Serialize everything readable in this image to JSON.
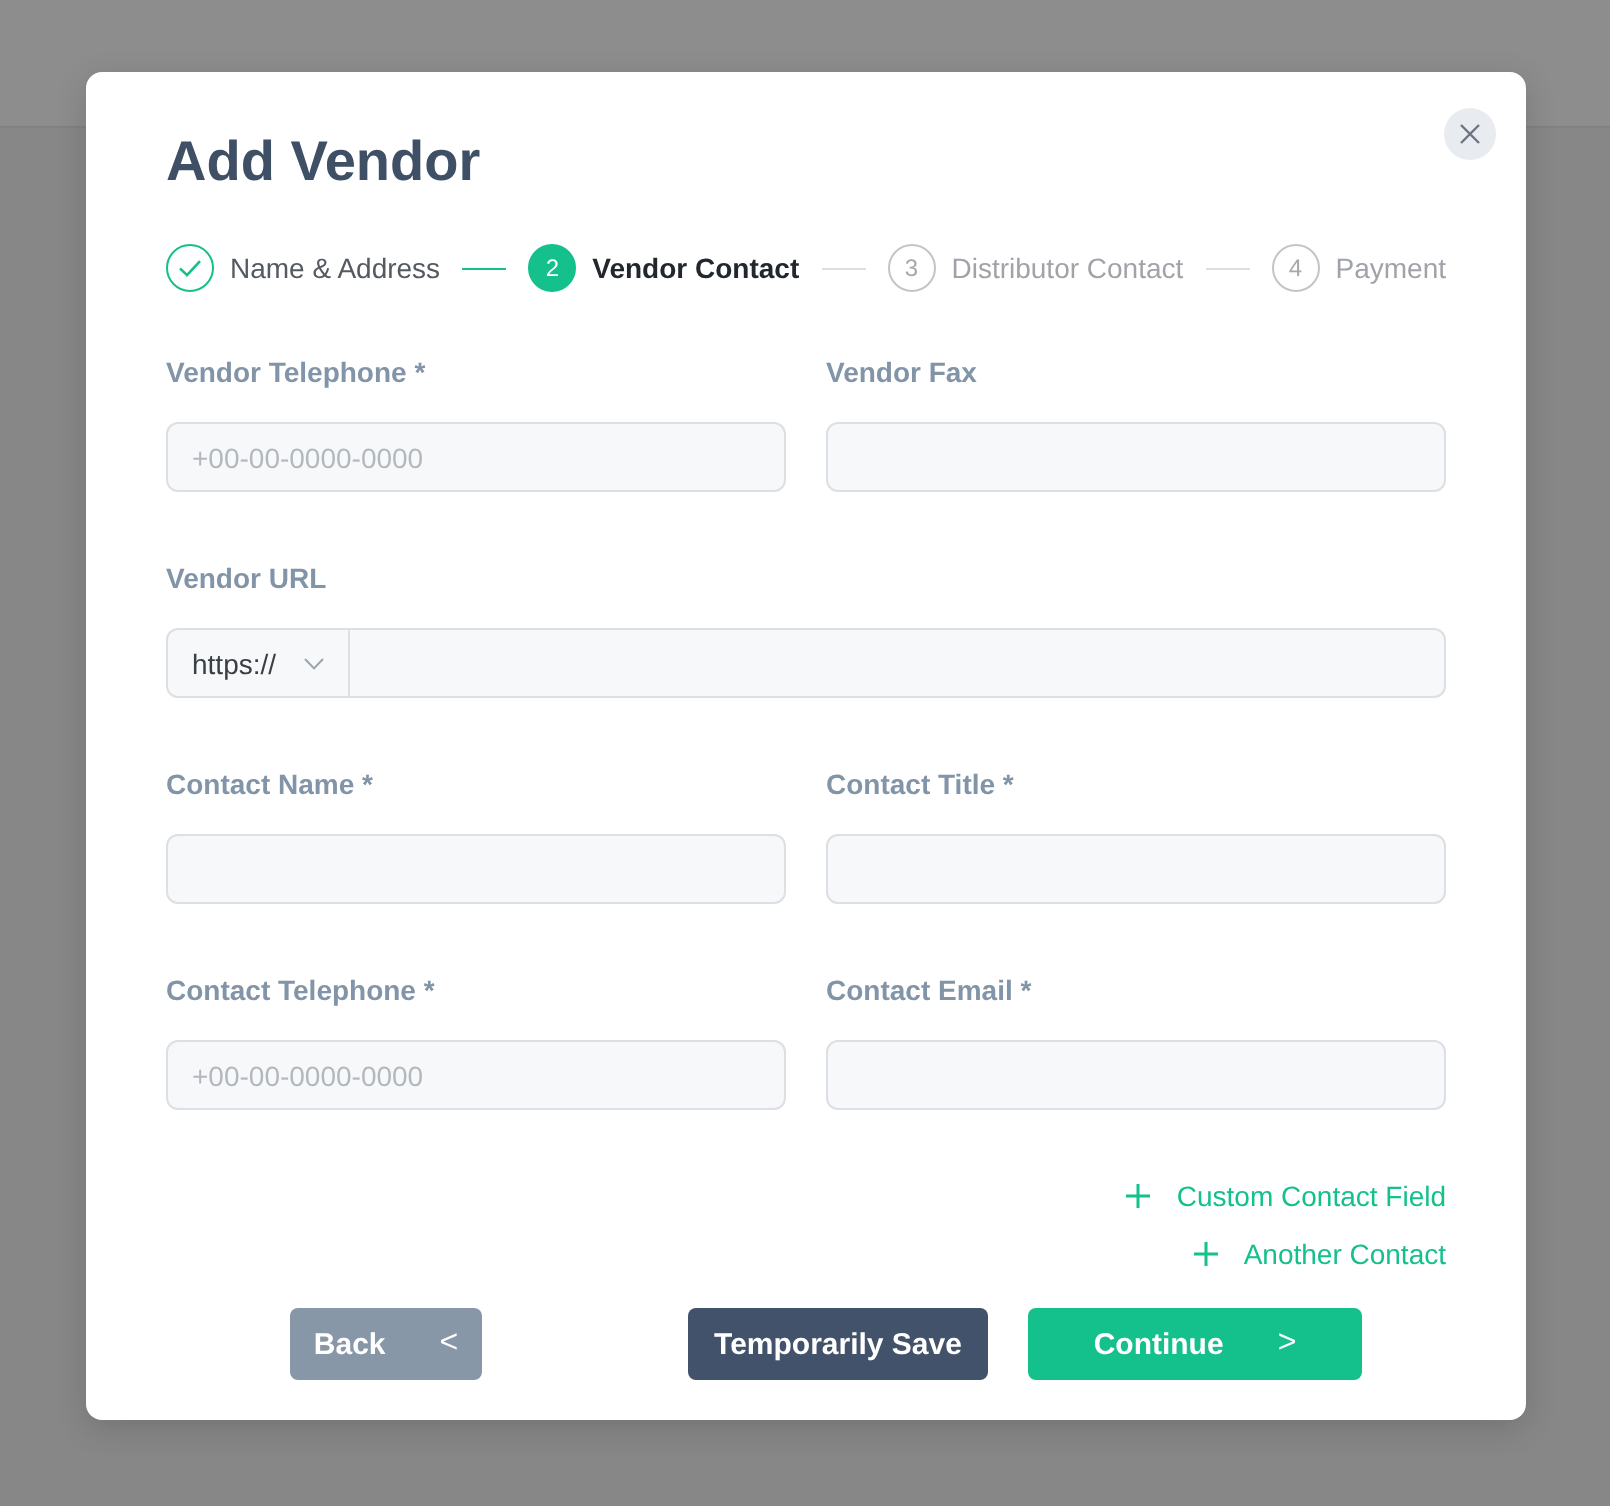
{
  "dialog": {
    "title": "Add Vendor"
  },
  "steps": [
    {
      "label": "Name & Address",
      "completed": true,
      "selected": false
    },
    {
      "number": "2",
      "label": "Vendor Contact",
      "completed": false,
      "selected": true
    },
    {
      "number": "3",
      "label": "Distributor Contact",
      "completed": false,
      "selected": false
    },
    {
      "number": "4",
      "label": "Payment",
      "completed": false,
      "selected": false
    }
  ],
  "fields": [
    {
      "kind": "text",
      "label": "Vendor Telephone *",
      "placeholder": "+00-00-0000-0000"
    },
    {
      "kind": "text",
      "label": "Vendor Fax"
    },
    {
      "kind": "url",
      "label": "Vendor URL",
      "protocol": "https://"
    },
    {
      "kind": "text",
      "label": "Contact Name *"
    },
    {
      "kind": "text",
      "label": "Contact Title *"
    },
    {
      "kind": "text",
      "label": "Contact Telephone *",
      "placeholder": "+00-00-0000-0000"
    },
    {
      "kind": "text",
      "label": "Contact Email *"
    }
  ],
  "links": [
    {
      "label": "Custom Contact Field"
    },
    {
      "label": "Another Contact"
    }
  ],
  "buttons": [
    {
      "kind": "back",
      "label": "Back",
      "arrow": "<"
    },
    {
      "kind": "save",
      "label": "Temporarily Save"
    },
    {
      "kind": "continue",
      "label": "Continue",
      "arrow": ">"
    }
  ]
}
